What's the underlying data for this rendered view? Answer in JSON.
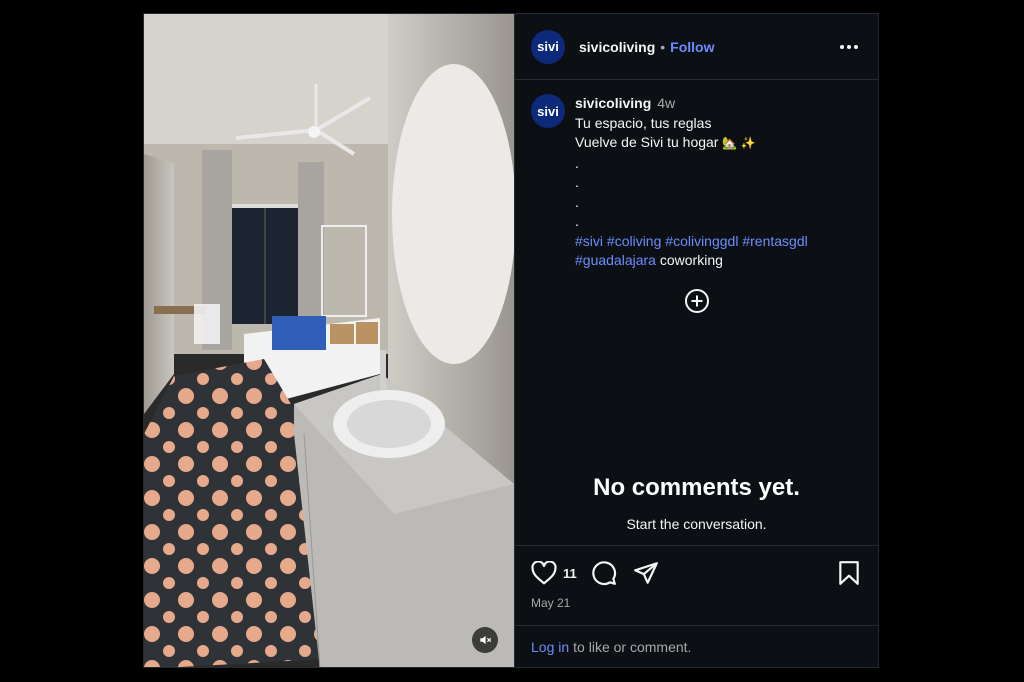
{
  "account": {
    "avatar_text": "sivi",
    "username": "sivicoliving",
    "separator": "•",
    "follow_label": "Follow"
  },
  "caption": {
    "username": "sivicoliving",
    "time": "4w",
    "line1": "Tu espacio, tus reglas",
    "line2": "Vuelve de Sivi tu hogar",
    "emoji": "🏡 ✨",
    "dots": [
      ".",
      ".",
      ".",
      "."
    ],
    "hashtags": [
      "#sivi",
      "#coliving",
      "#colivinggdl",
      "#rentasgdl",
      "#guadalajara"
    ],
    "trailing_word": "coworking"
  },
  "comments": {
    "empty_title": "No comments yet.",
    "empty_subtitle": "Start the conversation."
  },
  "actions": {
    "like_count": "11",
    "date": "May 21"
  },
  "login": {
    "link_label": "Log in",
    "rest_text": "to like or comment."
  },
  "colors": {
    "background": "#000000",
    "panel": "#0c1014",
    "link": "#6b8cff",
    "avatar": "#0d2a7a"
  }
}
